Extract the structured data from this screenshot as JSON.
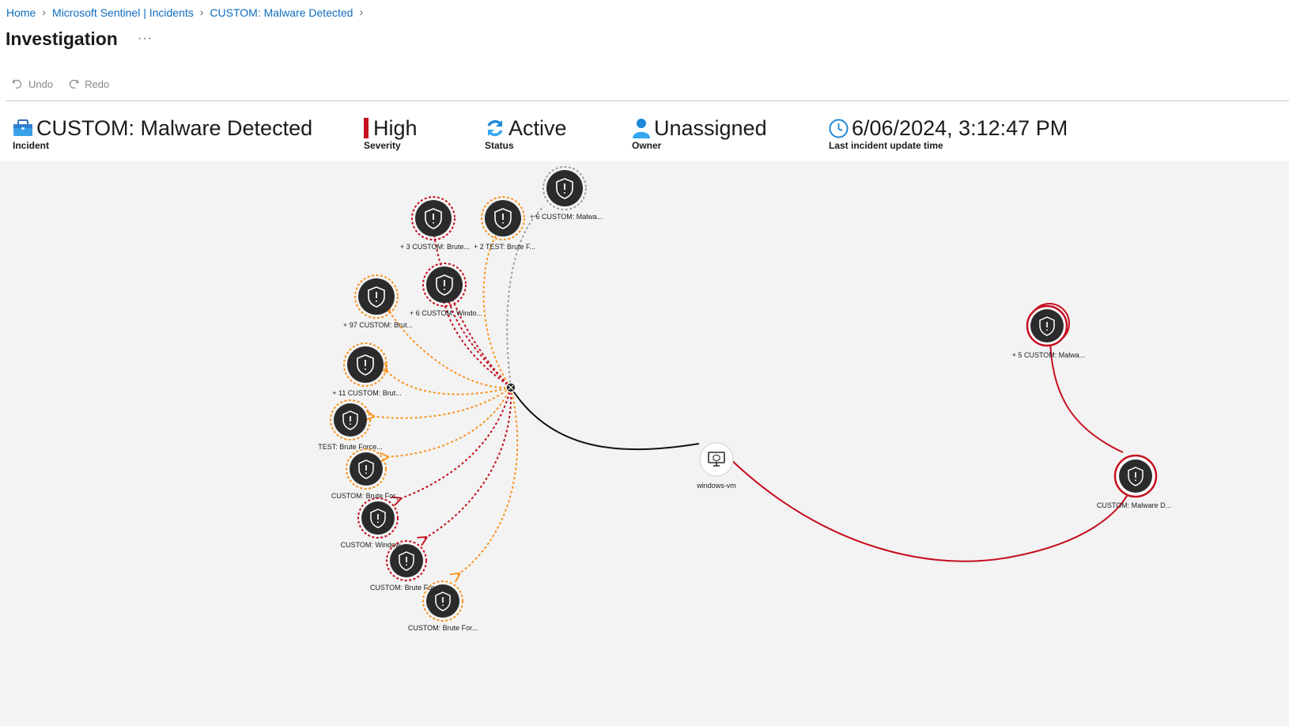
{
  "breadcrumb": [
    "Home",
    "Microsoft Sentinel | Incidents",
    "CUSTOM: Malware Detected"
  ],
  "page": {
    "title": "Investigation",
    "more": "···"
  },
  "toolbar": {
    "undo": "Undo",
    "redo": "Redo"
  },
  "summary": {
    "incident": {
      "value": "CUSTOM: Malware Detected",
      "label": "Incident"
    },
    "severity": {
      "value": "High",
      "label": "Severity"
    },
    "status": {
      "value": "Active",
      "label": "Status"
    },
    "owner": {
      "value": "Unassigned",
      "label": "Owner"
    },
    "updated": {
      "value": "6/06/2024, 3:12:47 PM",
      "label": "Last incident update time"
    }
  },
  "colors": {
    "link": "#0f6cbd",
    "high": "#c50f1f",
    "orange": "#f7931e",
    "gray": "#a0a0a0",
    "node": "#2b2b2b"
  },
  "graph": {
    "nodes": [
      {
        "id": "n1",
        "label": "+ 6 CUSTOM: Malwa...",
        "ring": "gray",
        "icon": "alert-shield-icon"
      },
      {
        "id": "n2",
        "label": "+ 3 CUSTOM: Brute...",
        "ring": "red",
        "icon": "alert-shield-icon"
      },
      {
        "id": "n3",
        "label": "+ 2 TEST: Brute F...",
        "ring": "orange",
        "icon": "alert-shield-icon"
      },
      {
        "id": "n4",
        "label": "+ 6 CUSTOM: Windo...",
        "ring": "red",
        "icon": "alert-shield-icon"
      },
      {
        "id": "n5",
        "label": "+ 97 CUSTOM: Brut...",
        "ring": "orange",
        "icon": "alert-shield-icon"
      },
      {
        "id": "n6",
        "label": "+ 11 CUSTOM: Brut...",
        "ring": "orange",
        "icon": "alert-shield-icon"
      },
      {
        "id": "n7",
        "label": "TEST: Brute Force...",
        "ring": "orange",
        "icon": "alert-shield-icon"
      },
      {
        "id": "n8",
        "label": "CUSTOM: Brute For...",
        "ring": "orange",
        "icon": "alert-shield-icon"
      },
      {
        "id": "n9",
        "label": "CUSTOM: Window...",
        "ring": "red",
        "icon": "alert-shield-icon"
      },
      {
        "id": "n10",
        "label": "CUSTOM: Brute For...",
        "ring": "red",
        "icon": "alert-shield-icon"
      },
      {
        "id": "n11",
        "label": "CUSTOM: Brute For...",
        "ring": "orange",
        "icon": "alert-shield-icon"
      },
      {
        "id": "n12",
        "label": "+ 5 CUSTOM: Malwa...",
        "ring": "red-solid",
        "icon": "alert-shield-icon"
      },
      {
        "id": "n13",
        "label": "CUSTOM: Malware D...",
        "ring": "red-solid",
        "icon": "alert-shield-icon"
      },
      {
        "id": "host",
        "label": "windows-vm",
        "ring": "none",
        "icon": "virtual-machine-icon"
      }
    ]
  }
}
